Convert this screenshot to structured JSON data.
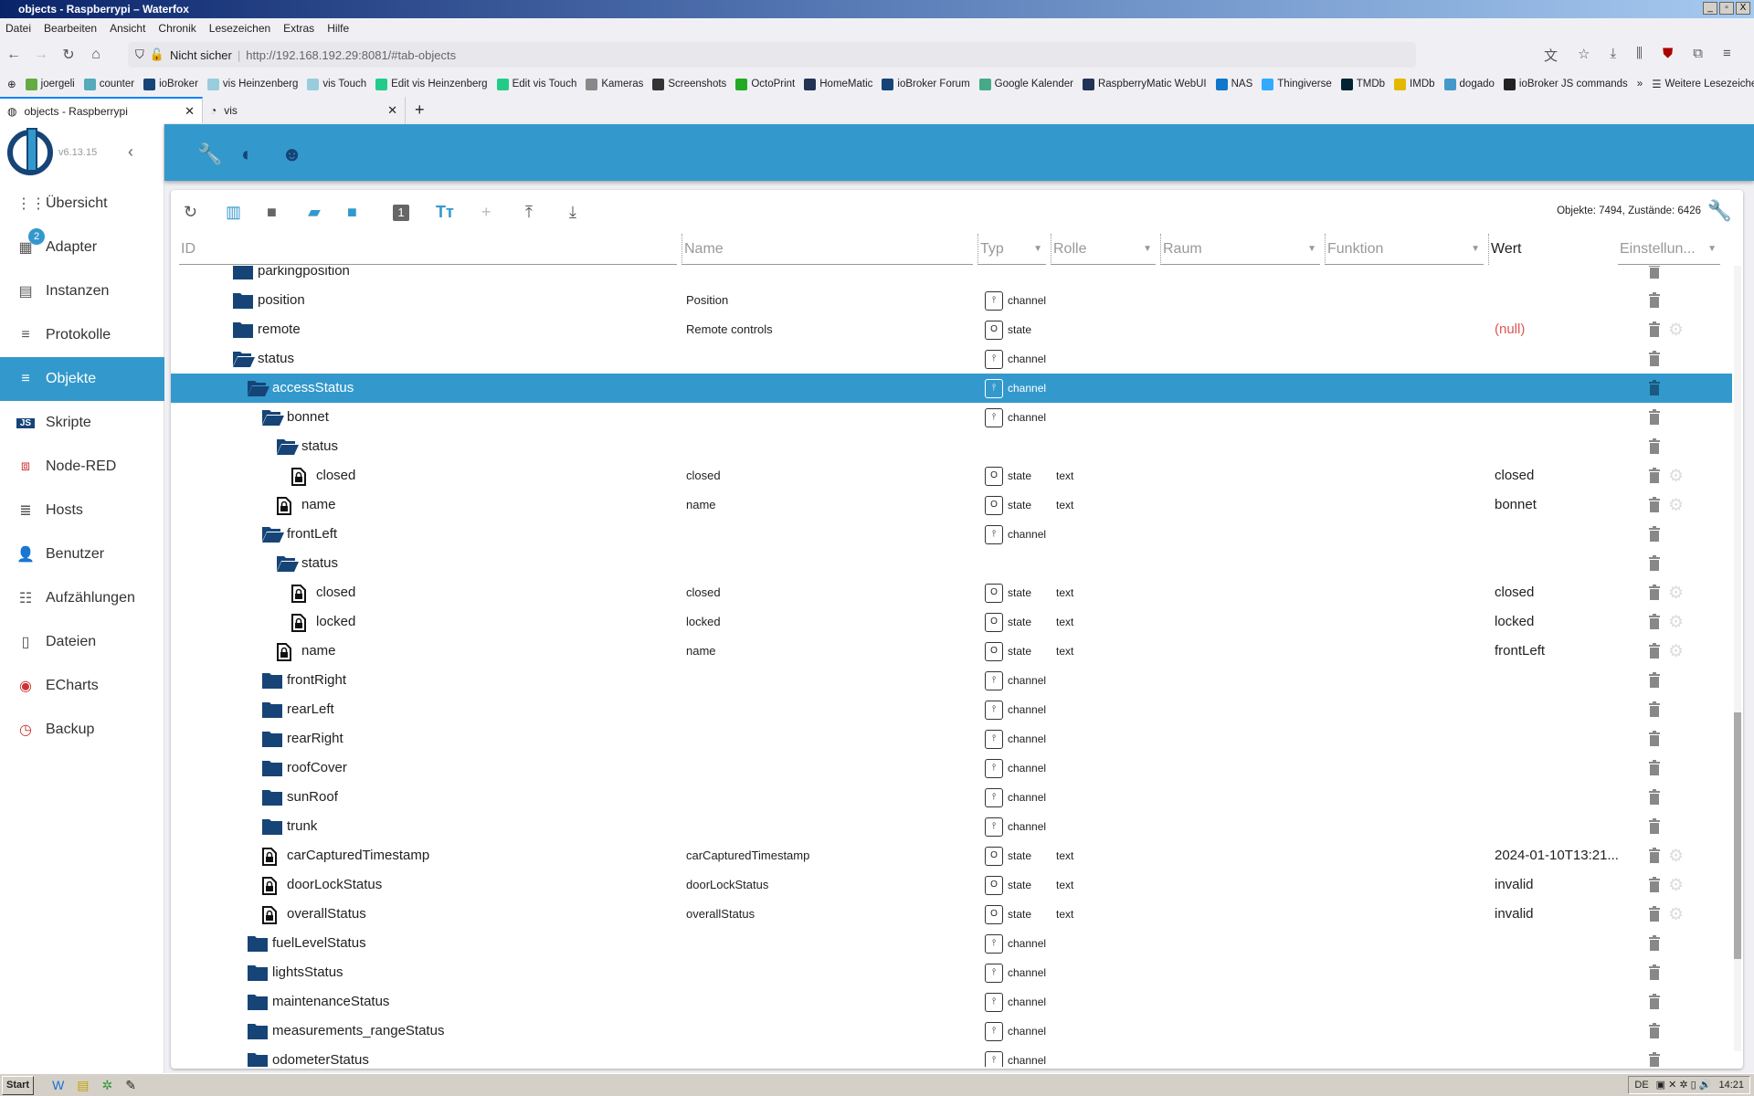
{
  "window": {
    "title": "objects - Raspberrypi – Waterfox"
  },
  "menu": [
    "Datei",
    "Bearbeiten",
    "Ansicht",
    "Chronik",
    "Lesezeichen",
    "Extras",
    "Hilfe"
  ],
  "url": {
    "security": "Nicht sicher",
    "text": "http://192.168.192.29:8081/#tab-objects"
  },
  "bookmarks": [
    "joergeli",
    "counter",
    "ioBroker",
    "vis Heinzenberg",
    "vis Touch",
    "Edit vis Heinzenberg",
    "Edit vis Touch",
    "Kameras",
    "Screenshots",
    "OctoPrint",
    "HomeMatic",
    "ioBroker Forum",
    "Google Kalender",
    "RaspberryMatic WebUI",
    "NAS",
    "Thingiverse",
    "TMDb",
    "IMDb",
    "dogado",
    "ioBroker JS commands"
  ],
  "bookmarks_more": "Weitere Lesezeichen",
  "tabs": [
    {
      "label": "objects - Raspberrypi",
      "active": true
    },
    {
      "label": "vis",
      "active": false
    }
  ],
  "app": {
    "version": "v6.13.15",
    "adapter_badge": "2"
  },
  "sidebar": [
    {
      "label": "Übersicht",
      "icon": "grid-icon"
    },
    {
      "label": "Adapter",
      "icon": "store-icon"
    },
    {
      "label": "Instanzen",
      "icon": "instances-icon"
    },
    {
      "label": "Protokolle",
      "icon": "list-icon"
    },
    {
      "label": "Objekte",
      "icon": "list-icon",
      "active": true
    },
    {
      "label": "Skripte",
      "icon": "js-icon"
    },
    {
      "label": "Node-RED",
      "icon": "node-red-icon"
    },
    {
      "label": "Hosts",
      "icon": "hosts-icon"
    },
    {
      "label": "Benutzer",
      "icon": "user-icon"
    },
    {
      "label": "Aufzählungen",
      "icon": "enum-icon"
    },
    {
      "label": "Dateien",
      "icon": "file-icon"
    },
    {
      "label": "ECharts",
      "icon": "echarts-icon"
    },
    {
      "label": "Backup",
      "icon": "backup-icon"
    }
  ],
  "toolbar": {
    "counts": "Objekte: 7494, Zustände: 6426"
  },
  "columns": {
    "id": "ID",
    "name": "Name",
    "type": "Typ",
    "role": "Rolle",
    "room": "Raum",
    "function": "Funktion",
    "value": "Wert",
    "settings": "Einstellun..."
  },
  "colors": {
    "accent": "#3399cc",
    "folder": "#164477",
    "null": "#e05555"
  },
  "rows": [
    {
      "level": 0,
      "icon": "folder",
      "id": "parkingposition",
      "name": "",
      "type": "",
      "role": "",
      "value": "",
      "gear": false
    },
    {
      "level": 0,
      "icon": "folder",
      "id": "position",
      "name": "Position",
      "type": "channel",
      "role": "",
      "value": "",
      "gear": false
    },
    {
      "level": 0,
      "icon": "folder",
      "id": "remote",
      "name": "Remote controls",
      "type": "state",
      "role": "",
      "value": "(null)",
      "null": true,
      "gear": true
    },
    {
      "level": 0,
      "icon": "folder-open",
      "id": "status",
      "name": "",
      "type": "channel",
      "role": "",
      "value": "",
      "gear": false
    },
    {
      "level": 1,
      "icon": "folder-open",
      "id": "accessStatus",
      "name": "",
      "type": "channel",
      "role": "",
      "value": "",
      "gear": false,
      "selected": true
    },
    {
      "level": 2,
      "icon": "folder-open",
      "id": "bonnet",
      "name": "",
      "type": "channel",
      "role": "",
      "value": "",
      "gear": false
    },
    {
      "level": 3,
      "icon": "folder-open",
      "id": "status",
      "name": "",
      "type": "",
      "role": "",
      "value": "",
      "gear": false
    },
    {
      "level": 4,
      "icon": "file",
      "id": "closed",
      "name": "closed",
      "type": "state",
      "role": "text",
      "value": "closed",
      "gear": true
    },
    {
      "level": 3,
      "icon": "file",
      "id": "name",
      "name": "name",
      "type": "state",
      "role": "text",
      "value": "bonnet",
      "gear": true
    },
    {
      "level": 2,
      "icon": "folder-open",
      "id": "frontLeft",
      "name": "",
      "type": "channel",
      "role": "",
      "value": "",
      "gear": false
    },
    {
      "level": 3,
      "icon": "folder-open",
      "id": "status",
      "name": "",
      "type": "",
      "role": "",
      "value": "",
      "gear": false
    },
    {
      "level": 4,
      "icon": "file",
      "id": "closed",
      "name": "closed",
      "type": "state",
      "role": "text",
      "value": "closed",
      "gear": true
    },
    {
      "level": 4,
      "icon": "file",
      "id": "locked",
      "name": "locked",
      "type": "state",
      "role": "text",
      "value": "locked",
      "gear": true
    },
    {
      "level": 3,
      "icon": "file",
      "id": "name",
      "name": "name",
      "type": "state",
      "role": "text",
      "value": "frontLeft",
      "gear": true
    },
    {
      "level": 2,
      "icon": "folder",
      "id": "frontRight",
      "name": "",
      "type": "channel",
      "role": "",
      "value": "",
      "gear": false
    },
    {
      "level": 2,
      "icon": "folder",
      "id": "rearLeft",
      "name": "",
      "type": "channel",
      "role": "",
      "value": "",
      "gear": false
    },
    {
      "level": 2,
      "icon": "folder",
      "id": "rearRight",
      "name": "",
      "type": "channel",
      "role": "",
      "value": "",
      "gear": false
    },
    {
      "level": 2,
      "icon": "folder",
      "id": "roofCover",
      "name": "",
      "type": "channel",
      "role": "",
      "value": "",
      "gear": false
    },
    {
      "level": 2,
      "icon": "folder",
      "id": "sunRoof",
      "name": "",
      "type": "channel",
      "role": "",
      "value": "",
      "gear": false
    },
    {
      "level": 2,
      "icon": "folder",
      "id": "trunk",
      "name": "",
      "type": "channel",
      "role": "",
      "value": "",
      "gear": false
    },
    {
      "level": 2,
      "icon": "file",
      "id": "carCapturedTimestamp",
      "name": "carCapturedTimestamp",
      "type": "state",
      "role": "text",
      "value": "2024-01-10T13:21...",
      "gear": true
    },
    {
      "level": 2,
      "icon": "file",
      "id": "doorLockStatus",
      "name": "doorLockStatus",
      "type": "state",
      "role": "text",
      "value": "invalid",
      "gear": true
    },
    {
      "level": 2,
      "icon": "file",
      "id": "overallStatus",
      "name": "overallStatus",
      "type": "state",
      "role": "text",
      "value": "invalid",
      "gear": true
    },
    {
      "level": 1,
      "icon": "folder",
      "id": "fuelLevelStatus",
      "name": "",
      "type": "channel",
      "role": "",
      "value": "",
      "gear": false
    },
    {
      "level": 1,
      "icon": "folder",
      "id": "lightsStatus",
      "name": "",
      "type": "channel",
      "role": "",
      "value": "",
      "gear": false
    },
    {
      "level": 1,
      "icon": "folder",
      "id": "maintenanceStatus",
      "name": "",
      "type": "channel",
      "role": "",
      "value": "",
      "gear": false
    },
    {
      "level": 1,
      "icon": "folder",
      "id": "measurements_rangeStatus",
      "name": "",
      "type": "channel",
      "role": "",
      "value": "",
      "gear": false
    },
    {
      "level": 1,
      "icon": "folder",
      "id": "odometerStatus",
      "name": "",
      "type": "channel",
      "role": "",
      "value": "",
      "gear": false
    }
  ],
  "taskbar": {
    "start": "Start",
    "lang": "DE",
    "clock": "14:21"
  }
}
